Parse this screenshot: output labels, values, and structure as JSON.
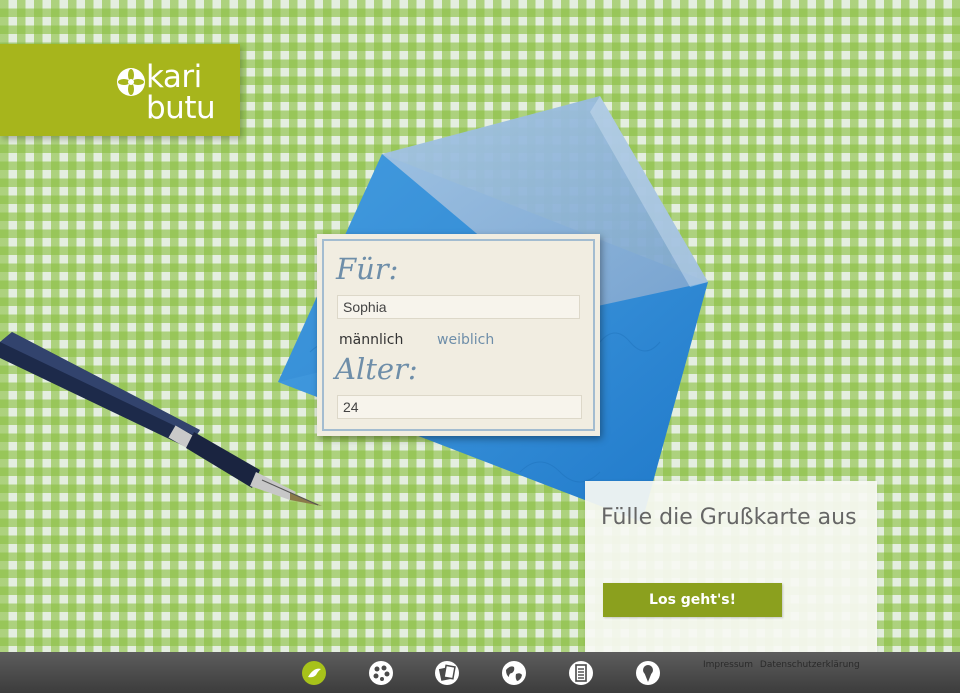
{
  "logo": {
    "line1": "kari",
    "line2": "butu"
  },
  "card": {
    "for_heading": "Für:",
    "name_value": "Sophia",
    "gender_male": "männlich",
    "gender_female": "weiblich",
    "age_heading": "Alter:",
    "age_value": "24"
  },
  "cta": {
    "title": "Fülle die Grußkarte aus",
    "button_label": "Los geht's!"
  },
  "footer": {
    "nav_icons": [
      "kaributu-home-icon",
      "palette-icon",
      "cards-icon",
      "globe-icon",
      "list-icon",
      "ice-cream-icon"
    ],
    "links": [
      "Impressum",
      "Datenschutzerklärung"
    ]
  },
  "colors": {
    "brand_green": "#a7b51c",
    "button_green": "#8ba01e",
    "gingham_green": "#8bbf42",
    "card_ink": "#6e8ea9",
    "footer_bg": "#4a4a4a",
    "active_nav": "#a7c21a"
  }
}
